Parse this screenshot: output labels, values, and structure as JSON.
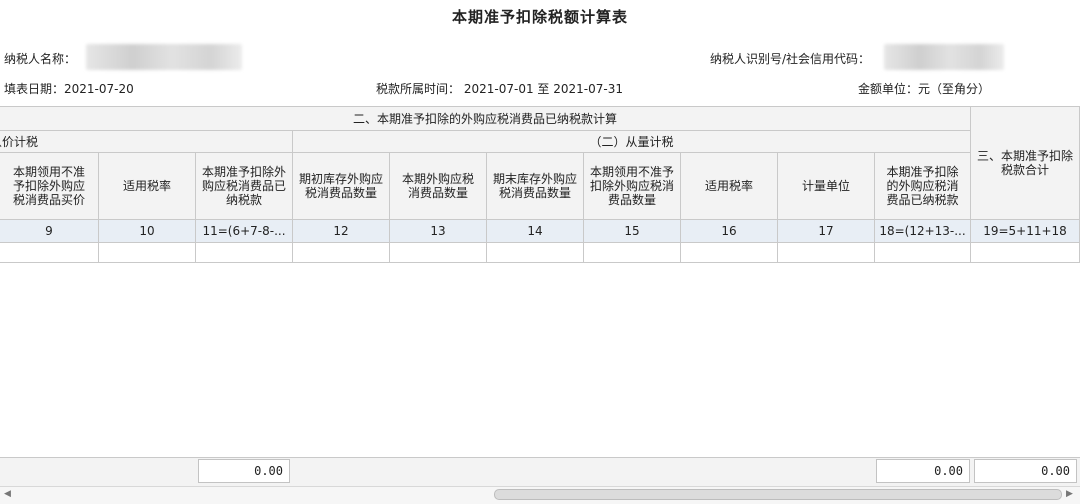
{
  "title": "本期准予扣除税额计算表",
  "taxpayer_name_label": "纳税人名称：",
  "taxpayer_id_label": "纳税人识别号/社会信用代码：",
  "fill_date_label": "填表日期：",
  "fill_date": "2021-07-20",
  "tax_period_label": "税款所属时间：",
  "tax_period_start": "2021-07-01",
  "tax_period_to": "至",
  "tax_period_end": "2021-07-31",
  "unit_label": "金额单位：元（至角分）",
  "table": {
    "group_header": "二、本期准予扣除的外购应税消费品已纳税款计算",
    "sub_left": "从价计税",
    "sub_right": "（二）从量计税",
    "right_header": "三、本期准予扣除税款合计",
    "columns": [
      "本期领用不准予扣除外购应税消费品买价",
      "适用税率",
      "本期准予扣除外购应税消费品已纳税款",
      "期初库存外购应税消费品数量",
      "本期外购应税消费品数量",
      "期末库存外购应税消费品数量",
      "本期领用不准予扣除外购应税消费品数量",
      "适用税率",
      "计量单位",
      "本期准予扣除的外购应税消费品已纳税款"
    ],
    "col_numbers": [
      "9",
      "10",
      "11=(6+7-8-...",
      "12",
      "13",
      "14",
      "15",
      "16",
      "17",
      "18=(12+13-...",
      "19=5+11+18"
    ],
    "totals": {
      "col11": "0.00",
      "col18": "0.00",
      "col19": "0.00"
    }
  }
}
